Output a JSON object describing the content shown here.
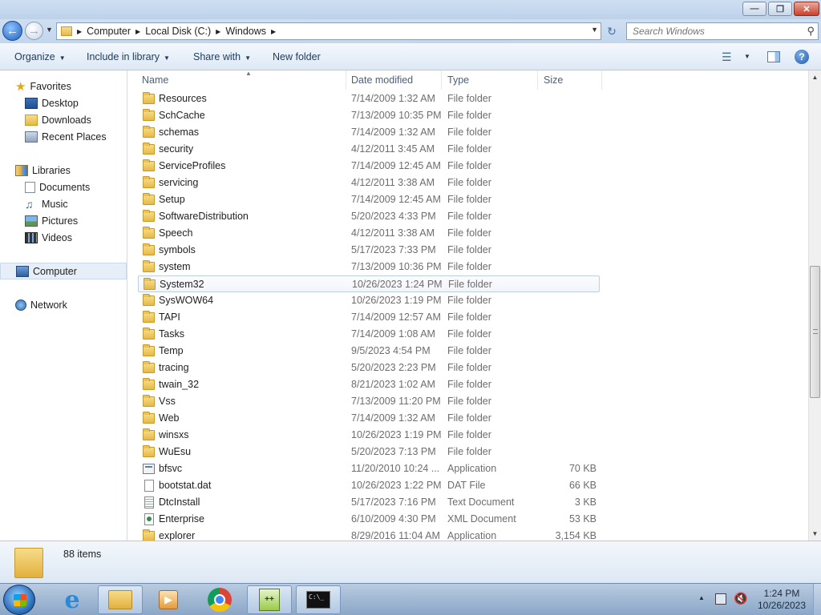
{
  "window": {
    "caption_buttons": {
      "minimize": "—",
      "maximize": "❐",
      "close": "✕"
    }
  },
  "address_bar": {
    "breadcrumbs": [
      "Computer",
      "Local Disk (C:)",
      "Windows"
    ],
    "search_placeholder": "Search Windows"
  },
  "toolbar": {
    "organize": "Organize",
    "include_in_library": "Include in library",
    "share_with": "Share with",
    "new_folder": "New folder"
  },
  "nav_pane": {
    "favorites": "Favorites",
    "desktop": "Desktop",
    "downloads": "Downloads",
    "recent_places": "Recent Places",
    "libraries": "Libraries",
    "documents": "Documents",
    "music": "Music",
    "pictures": "Pictures",
    "videos": "Videos",
    "computer": "Computer",
    "network": "Network"
  },
  "columns": {
    "name": "Name",
    "date_modified": "Date modified",
    "type": "Type",
    "size": "Size"
  },
  "files": [
    {
      "name": "Resources",
      "date": "7/14/2009 1:32 AM",
      "type": "File folder",
      "size": "",
      "icon": "folder-icon"
    },
    {
      "name": "SchCache",
      "date": "7/13/2009 10:35 PM",
      "type": "File folder",
      "size": "",
      "icon": "folder-icon"
    },
    {
      "name": "schemas",
      "date": "7/14/2009 1:32 AM",
      "type": "File folder",
      "size": "",
      "icon": "folder-icon"
    },
    {
      "name": "security",
      "date": "4/12/2011 3:45 AM",
      "type": "File folder",
      "size": "",
      "icon": "folder-icon"
    },
    {
      "name": "ServiceProfiles",
      "date": "7/14/2009 12:45 AM",
      "type": "File folder",
      "size": "",
      "icon": "folder-icon"
    },
    {
      "name": "servicing",
      "date": "4/12/2011 3:38 AM",
      "type": "File folder",
      "size": "",
      "icon": "folder-icon"
    },
    {
      "name": "Setup",
      "date": "7/14/2009 12:45 AM",
      "type": "File folder",
      "size": "",
      "icon": "folder-icon"
    },
    {
      "name": "SoftwareDistribution",
      "date": "5/20/2023 4:33 PM",
      "type": "File folder",
      "size": "",
      "icon": "folder-icon"
    },
    {
      "name": "Speech",
      "date": "4/12/2011 3:38 AM",
      "type": "File folder",
      "size": "",
      "icon": "folder-icon"
    },
    {
      "name": "symbols",
      "date": "5/17/2023 7:33 PM",
      "type": "File folder",
      "size": "",
      "icon": "folder-icon"
    },
    {
      "name": "system",
      "date": "7/13/2009 10:36 PM",
      "type": "File folder",
      "size": "",
      "icon": "folder-icon"
    },
    {
      "name": "System32",
      "date": "10/26/2023 1:24 PM",
      "type": "File folder",
      "size": "",
      "icon": "folder-icon"
    },
    {
      "name": "SysWOW64",
      "date": "10/26/2023 1:19 PM",
      "type": "File folder",
      "size": "",
      "icon": "folder-icon"
    },
    {
      "name": "TAPI",
      "date": "7/14/2009 12:57 AM",
      "type": "File folder",
      "size": "",
      "icon": "folder-icon"
    },
    {
      "name": "Tasks",
      "date": "7/14/2009 1:08 AM",
      "type": "File folder",
      "size": "",
      "icon": "folder-icon"
    },
    {
      "name": "Temp",
      "date": "9/5/2023 4:54 PM",
      "type": "File folder",
      "size": "",
      "icon": "folder-icon"
    },
    {
      "name": "tracing",
      "date": "5/20/2023 2:23 PM",
      "type": "File folder",
      "size": "",
      "icon": "folder-icon"
    },
    {
      "name": "twain_32",
      "date": "8/21/2023 1:02 AM",
      "type": "File folder",
      "size": "",
      "icon": "folder-icon"
    },
    {
      "name": "Vss",
      "date": "7/13/2009 11:20 PM",
      "type": "File folder",
      "size": "",
      "icon": "folder-icon"
    },
    {
      "name": "Web",
      "date": "7/14/2009 1:32 AM",
      "type": "File folder",
      "size": "",
      "icon": "folder-icon"
    },
    {
      "name": "winsxs",
      "date": "10/26/2023 1:19 PM",
      "type": "File folder",
      "size": "",
      "icon": "folder-icon"
    },
    {
      "name": "WuEsu",
      "date": "5/20/2023 7:13 PM",
      "type": "File folder",
      "size": "",
      "icon": "folder-icon"
    },
    {
      "name": "bfsvc",
      "date": "11/20/2010 10:24 ...",
      "type": "Application",
      "size": "70 KB",
      "icon": "application-icon"
    },
    {
      "name": "bootstat.dat",
      "date": "10/26/2023 1:22 PM",
      "type": "DAT File",
      "size": "66 KB",
      "icon": "file-icon"
    },
    {
      "name": "DtcInstall",
      "date": "5/17/2023 7:16 PM",
      "type": "Text Document",
      "size": "3 KB",
      "icon": "text-document-icon"
    },
    {
      "name": "Enterprise",
      "date": "6/10/2009 4:30 PM",
      "type": "XML Document",
      "size": "53 KB",
      "icon": "xml-document-icon"
    },
    {
      "name": "explorer",
      "date": "8/29/2016 11:04 AM",
      "type": "Application",
      "size": "3,154 KB",
      "icon": "explorer-application-icon"
    }
  ],
  "status": {
    "item_count": "88 items"
  },
  "taskbar": {
    "pinned": [
      "internet-explorer-icon",
      "windows-explorer-icon",
      "media-player-icon",
      "chrome-icon",
      "notepad-plus-plus-icon",
      "command-prompt-icon"
    ],
    "clock_time": "1:24 PM",
    "clock_date": "10/26/2023"
  }
}
